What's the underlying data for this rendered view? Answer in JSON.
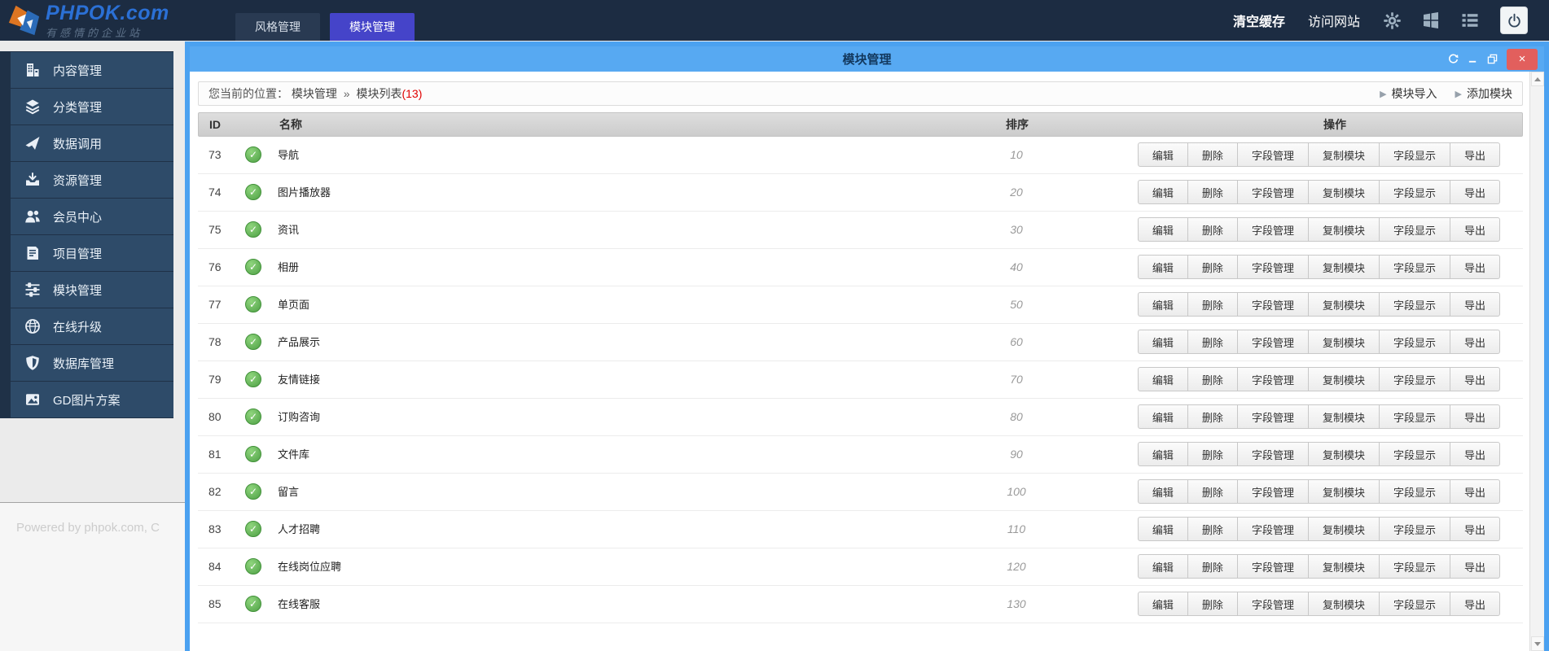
{
  "header": {
    "logo": {
      "title": "PHPOK.com",
      "tagline": "有感情的企业站"
    },
    "tabs": [
      {
        "label": "风格管理",
        "active": false
      },
      {
        "label": "模块管理",
        "active": true
      }
    ],
    "clear_cache": "清空缓存",
    "visit_site": "访问网站",
    "icons": [
      "gear-icon",
      "windows-icon",
      "list-icon",
      "power-icon"
    ]
  },
  "sidebar": {
    "items": [
      {
        "icon": "building-icon",
        "label": "内容管理"
      },
      {
        "icon": "layers-icon",
        "label": "分类管理"
      },
      {
        "icon": "rocket-icon",
        "label": "数据调用"
      },
      {
        "icon": "download-icon",
        "label": "资源管理"
      },
      {
        "icon": "users-icon",
        "label": "会员中心"
      },
      {
        "icon": "book-icon",
        "label": "项目管理"
      },
      {
        "icon": "sliders-icon",
        "label": "模块管理"
      },
      {
        "icon": "globe-icon",
        "label": "在线升级"
      },
      {
        "icon": "shield-icon",
        "label": "数据库管理"
      },
      {
        "icon": "image-icon",
        "label": "GD图片方案"
      }
    ],
    "footer_text": "Powered by phpok.com, C"
  },
  "window": {
    "title": "模块管理"
  },
  "breadcrumb": {
    "prefix": "您当前的位置：",
    "path1": "模块管理",
    "separator": "»",
    "path2": "模块列表",
    "count": "(13)"
  },
  "toolbar": {
    "import_label": "模块导入",
    "add_label": "添加模块"
  },
  "table": {
    "headers": [
      "ID",
      "名称",
      "排序",
      "操作"
    ],
    "action_labels": [
      "编辑",
      "删除",
      "字段管理",
      "复制模块",
      "字段显示",
      "导出"
    ],
    "rows": [
      {
        "id": "73",
        "name": "导航",
        "sort": "10"
      },
      {
        "id": "74",
        "name": "图片播放器",
        "sort": "20"
      },
      {
        "id": "75",
        "name": "资讯",
        "sort": "30"
      },
      {
        "id": "76",
        "name": "相册",
        "sort": "40"
      },
      {
        "id": "77",
        "name": "单页面",
        "sort": "50"
      },
      {
        "id": "78",
        "name": "产品展示",
        "sort": "60"
      },
      {
        "id": "79",
        "name": "友情链接",
        "sort": "70"
      },
      {
        "id": "80",
        "name": "订购咨询",
        "sort": "80"
      },
      {
        "id": "81",
        "name": "文件库",
        "sort": "90"
      },
      {
        "id": "82",
        "name": "留言",
        "sort": "100"
      },
      {
        "id": "83",
        "name": "人才招聘",
        "sort": "110"
      },
      {
        "id": "84",
        "name": "在线岗位应聘",
        "sort": "120"
      },
      {
        "id": "85",
        "name": "在线客服",
        "sort": "130"
      }
    ]
  },
  "colors": {
    "header_bg": "#1c2c42",
    "active_tab": "#4544c9",
    "accent_border": "#4ba1f0",
    "titlebar": "#57a9f2",
    "close_button": "#e25f5d",
    "status_green": "#4ea045",
    "count_red": "#e00000"
  }
}
